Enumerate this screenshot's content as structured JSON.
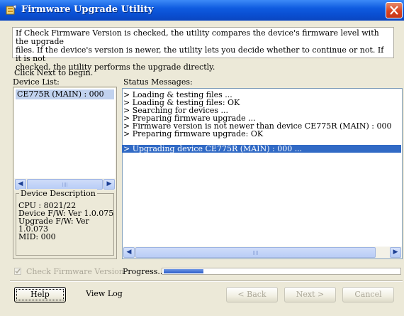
{
  "window": {
    "title": "Firmware Upgrade Utility",
    "colors": {
      "titlebar": "#0a4fd2",
      "face": "#ece9d8",
      "selection": "#316ac5",
      "device_selection": "#c1d2ee"
    }
  },
  "info": {
    "lines": [
      "If Check Firmware Version is checked, the utility compares the device's firmware level with the upgrade",
      "files. If the device's version is newer, the utility lets you decide whether to continue or not. If it is not",
      "checked, the utility performs the upgrade directly."
    ],
    "click_next": "Click Next to begin."
  },
  "device_list": {
    "label": "Device List:",
    "items": [
      "CE775R (MAIN) : 000"
    ]
  },
  "device_description": {
    "legend": "Device Description",
    "lines": [
      "CPU : 8021/22",
      "Device F/W: Ver 1.0.075",
      "Upgrade F/W: Ver",
      "1.0.073",
      "MID: 000"
    ]
  },
  "status": {
    "label": "Status Messages:",
    "messages": [
      "> Loading & testing files ...",
      "> Loading & testing files: OK",
      "> Searching for devices ...",
      "> Preparing firmware upgrade ...",
      "> Firmware version is not newer than device CE775R (MAIN) : 000",
      "> Preparing firmware upgrade: OK",
      "> Upgrading device CE775R (MAIN) : 000 ..."
    ],
    "selected_index": 6
  },
  "options": {
    "check_firmware_label": "Check Firmware Version",
    "check_firmware_checked": true,
    "check_firmware_enabled": false
  },
  "progress": {
    "label": "Progress...",
    "value": 0.17
  },
  "buttons": {
    "help": "Help",
    "view_log": "View Log",
    "back": "< Back",
    "next": "Next >",
    "cancel": "Cancel"
  },
  "icons": {
    "app": "firmware-utility-icon",
    "close": "close-icon",
    "scroll_left": "scroll-left-arrow-icon",
    "scroll_right": "scroll-right-arrow-icon",
    "checkmark": "checkmark-icon"
  }
}
